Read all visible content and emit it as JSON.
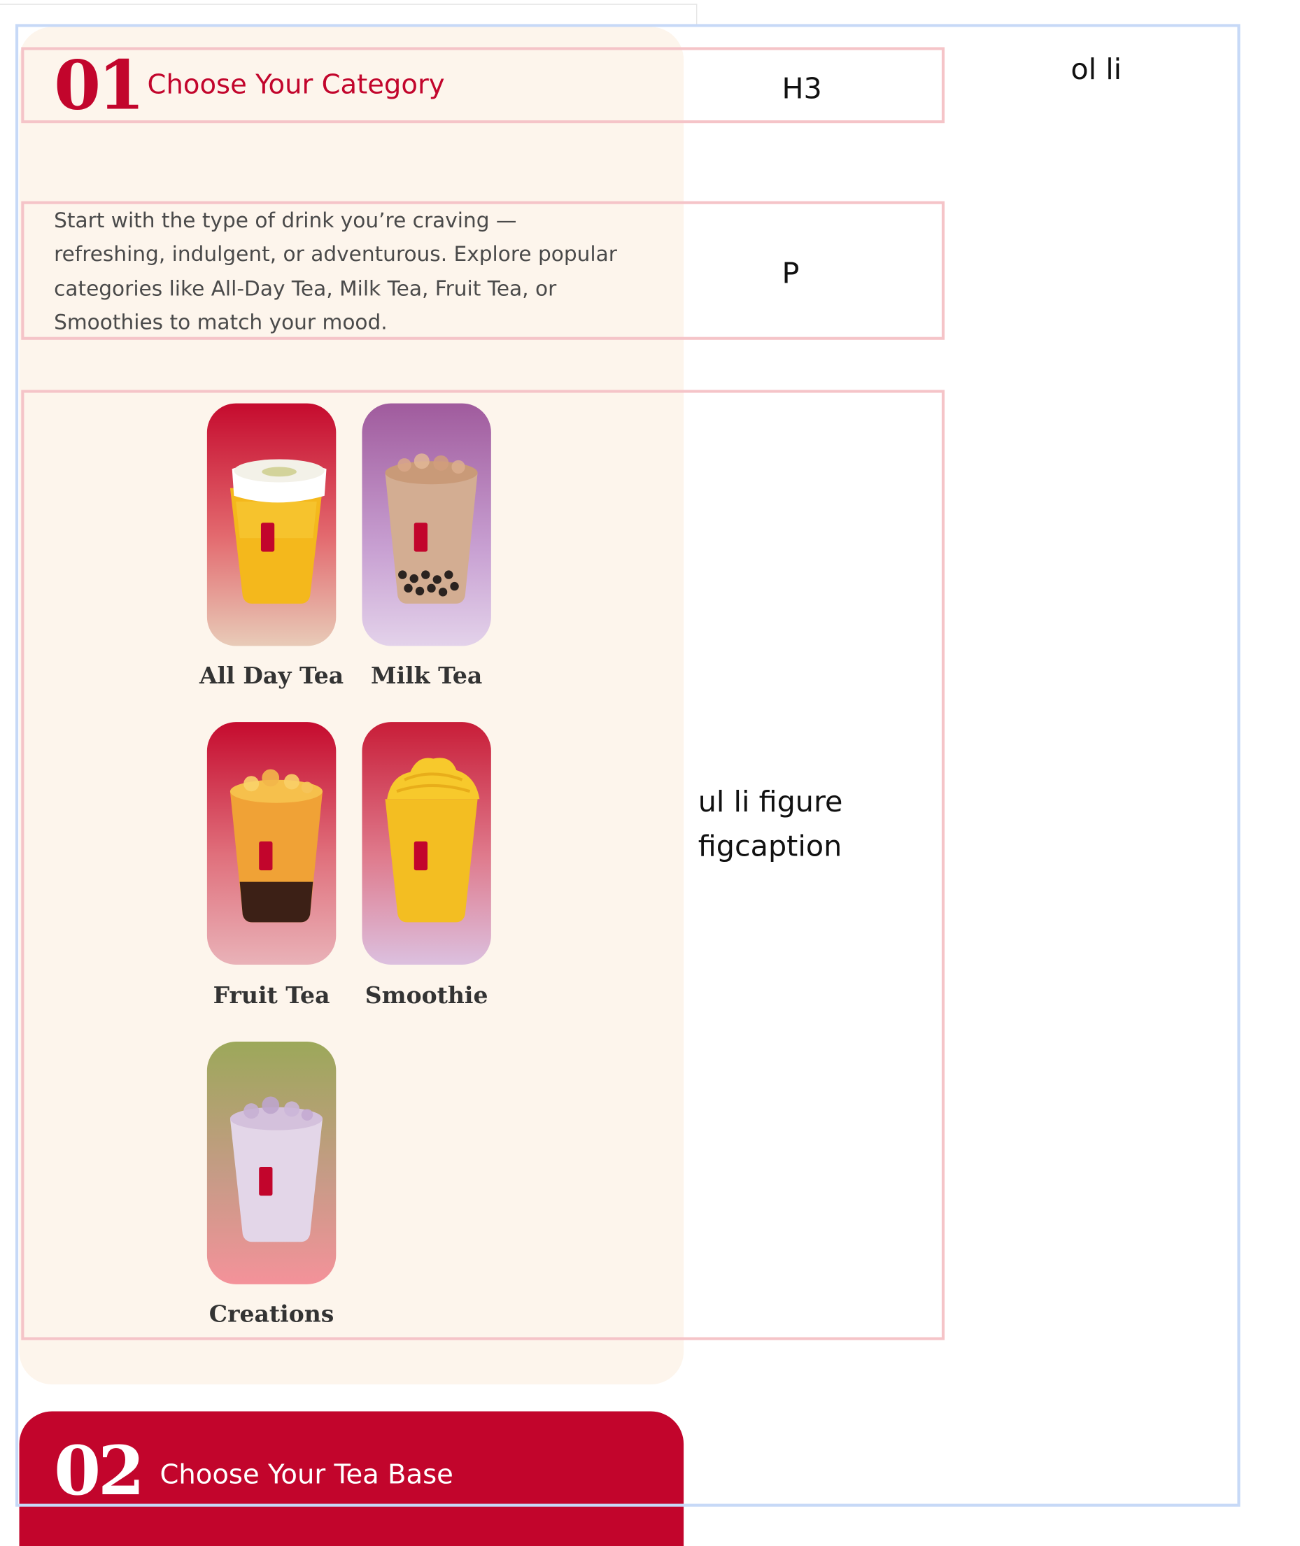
{
  "steps": [
    {
      "number": "01",
      "title": "Choose Your Category",
      "description": "Start with the type of drink you’re craving — refreshing, indulgent, or adventurous. Explore popular categories like All-Day Tea, Milk Tea, Fruit Tea, or Smoothies to match your mood."
    },
    {
      "number": "02",
      "title": "Choose Your Tea Base"
    }
  ],
  "categories": [
    {
      "label": "All Day Tea",
      "icon": "all-day-tea-cup-image"
    },
    {
      "label": "Milk Tea",
      "icon": "milk-tea-cup-image"
    },
    {
      "label": "Fruit Tea",
      "icon": "fruit-tea-cup-image"
    },
    {
      "label": "Smoothie",
      "icon": "smoothie-cup-image"
    },
    {
      "label": "Creations",
      "icon": "creations-cup-image"
    }
  ],
  "annotations": {
    "heading": "H3",
    "paragraph": "P",
    "list_item": "ol li",
    "figure_list": "ul li figure figcaption"
  },
  "colors": {
    "brand_red": "#c2052c",
    "card_cream": "#fdf5ec",
    "outline_blue": "#c7d9f7",
    "outline_pink": "#f5c4c8"
  }
}
